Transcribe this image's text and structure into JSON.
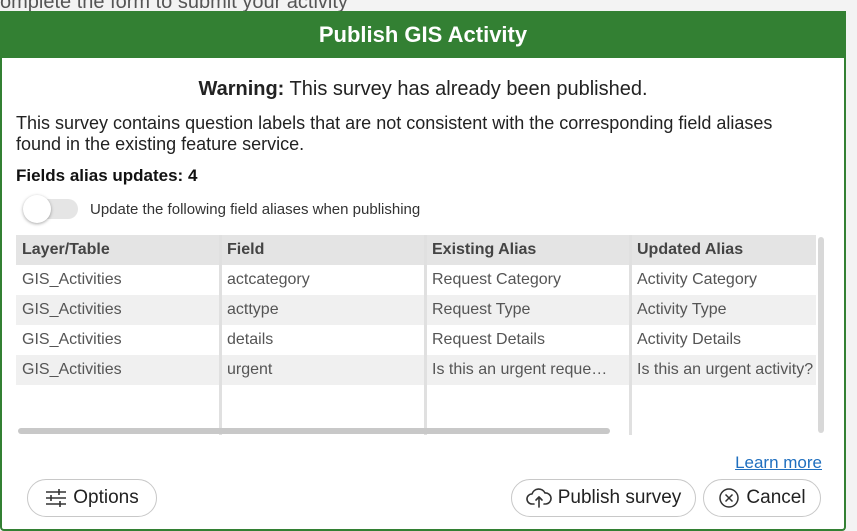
{
  "backdrop": {
    "text": "omplete the form to submit your activity"
  },
  "dialog": {
    "title": "Publish GIS Activity",
    "warning_prefix": "Warning:",
    "warning_text": " This survey has already been published.",
    "description": "This survey contains question labels that are not consistent with the corresponding field aliases found in the existing feature service.",
    "fields_count": "Fields alias updates: 4",
    "toggle_label": "Update the following field aliases when publishing",
    "toggle_on": false
  },
  "table": {
    "headers": [
      "Layer/Table",
      "Field",
      "Existing Alias",
      "Updated Alias"
    ],
    "rows": [
      [
        "GIS_Activities",
        "actcategory",
        "Request Category",
        "Activity Category"
      ],
      [
        "GIS_Activities",
        "acttype",
        "Request Type",
        "Activity Type"
      ],
      [
        "GIS_Activities",
        "details",
        "Request Details",
        "Activity Details"
      ],
      [
        "GIS_Activities",
        "urgent",
        "Is this an urgent reque…",
        "Is this an urgent activity?"
      ]
    ]
  },
  "footer": {
    "learn_more": "Learn more",
    "options_label": "Options",
    "publish_label": "Publish survey",
    "cancel_label": "Cancel"
  },
  "colors": {
    "title_bar": "#338033",
    "link": "#1f6fbf"
  },
  "icons": {
    "options": "sliders-icon",
    "publish": "cloud-upload-icon",
    "cancel": "x-circle-icon"
  }
}
